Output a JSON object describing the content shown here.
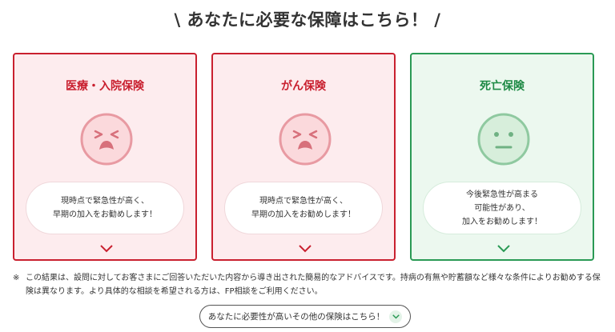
{
  "heading": "\\ あなたに必要な保障はこちら！ /",
  "colors": {
    "red": "#c9202f",
    "green": "#2a9a55"
  },
  "cards": [
    {
      "title": "医療・入院保険",
      "face_icon": "worried-face-icon",
      "message": [
        "現時点で緊急性が高く、",
        "早期の加入をお勧めします！"
      ],
      "expand_icon": "chevron-down-icon"
    },
    {
      "title": "がん保険",
      "face_icon": "worried-face-icon",
      "message": [
        "現時点で緊急性が高く、",
        "早期の加入をお勧めします！"
      ],
      "expand_icon": "chevron-down-icon"
    },
    {
      "title": "死亡保険",
      "face_icon": "neutral-face-icon",
      "message": [
        "今後緊急性が高まる",
        "可能性があり、",
        "加入をお勧めします！"
      ],
      "expand_icon": "chevron-down-icon"
    }
  ],
  "note": {
    "mark": "※",
    "text": "この結果は、設問に対してお客さまにご回答いただいた内容から導き出された簡易的なアドバイスです。持病の有無や貯蓄額など様々な条件によりお勧めする保険は異なります。より具体的な相談を希望される方は、FP相談をご利用ください。"
  },
  "more_button": {
    "label": "あなたに必要性が高いその他の保険はこちら！",
    "icon": "chevron-down-icon"
  }
}
